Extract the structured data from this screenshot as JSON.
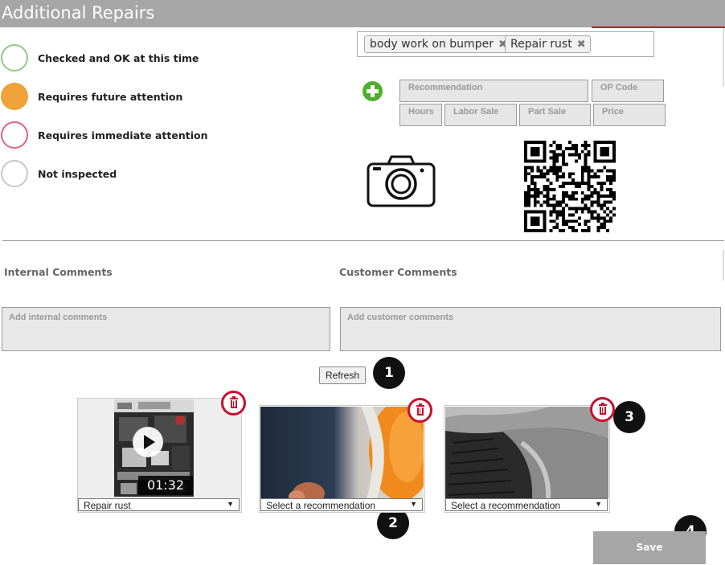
{
  "header": {
    "title": "Additional Repairs"
  },
  "legend": [
    {
      "label": "Checked and OK at this time",
      "border": "#8fcc84",
      "fill": "#ffffff"
    },
    {
      "label": "Requires future attention",
      "border": "#e8a23a",
      "fill": "#f0a33a"
    },
    {
      "label": "Requires immediate attention",
      "border": "#d9667e",
      "fill": "#ffffff"
    },
    {
      "label": "Not inspected",
      "border": "#c8c8c8",
      "fill": "#ffffff"
    }
  ],
  "tags": [
    {
      "label": "body work on bumper",
      "remove": "✖"
    },
    {
      "label": "Repair rust",
      "remove": "✖"
    }
  ],
  "form": {
    "recommendation": {
      "placeholder": "Recommendation"
    },
    "op_code": {
      "placeholder": "OP Code"
    },
    "hours": {
      "placeholder": "Hours"
    },
    "labor_sale": {
      "placeholder": "Labor Sale"
    },
    "part_sale": {
      "placeholder": "Part Sale"
    },
    "price": {
      "placeholder": "Price"
    }
  },
  "comments": {
    "internal_label": "Internal Comments",
    "internal_placeholder": "Add internal comments",
    "customer_label": "Customer Comments",
    "customer_placeholder": "Add customer comments"
  },
  "refresh_label": "Refresh",
  "badges": [
    "1",
    "2",
    "3",
    "4"
  ],
  "media": [
    {
      "kind": "video",
      "duration": "01:32",
      "selection": "Repair rust"
    },
    {
      "kind": "photo",
      "selection": "Select a recommendation"
    },
    {
      "kind": "photo",
      "selection": "Select a recommendation"
    }
  ],
  "save_label": "Save",
  "colors": {
    "header": "#a6a6a6",
    "accent_red": "#c8102e",
    "add_green": "#4caf2a",
    "save": "#a6a6a6"
  },
  "icons": [
    "add-icon",
    "camera-icon",
    "qr-code-icon",
    "trash-icon",
    "play-icon",
    "dropdown-arrow-icon"
  ]
}
